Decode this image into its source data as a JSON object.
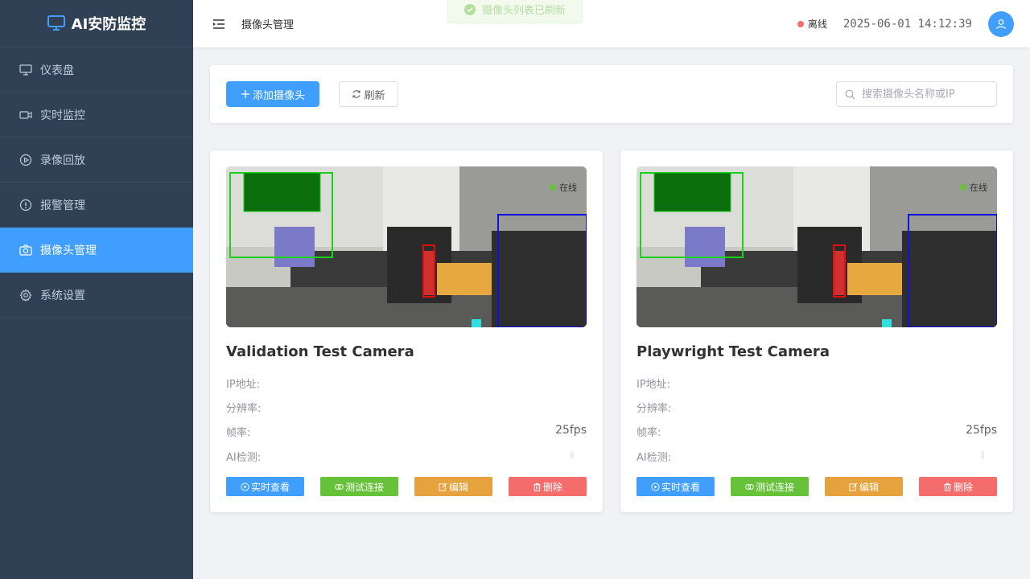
{
  "app": {
    "title": "AI安防监控"
  },
  "sidebar": {
    "items": [
      {
        "label": "仪表盘",
        "icon": "monitor-icon"
      },
      {
        "label": "实时监控",
        "icon": "video-camera-icon"
      },
      {
        "label": "录像回放",
        "icon": "play-circle-icon"
      },
      {
        "label": "报警管理",
        "icon": "warning-icon"
      },
      {
        "label": "摄像头管理",
        "icon": "camera-icon",
        "active": true
      },
      {
        "label": "系统设置",
        "icon": "gear-icon"
      }
    ]
  },
  "header": {
    "breadcrumb": "摄像头管理",
    "status_label": "离线",
    "status_color": "#f56c6c",
    "datetime": "2025-06-01 14:12:39"
  },
  "toast": {
    "message": "摄像头列表已刷新"
  },
  "toolbar": {
    "add_label": "添加摄像头",
    "refresh_label": "刷新",
    "search_placeholder": "搜索摄像头名称或IP"
  },
  "cameras": [
    {
      "name": "Validation Test Camera",
      "status": "在线",
      "ip_label": "IP地址:",
      "ip_value": "",
      "resolution_label": "分辨率:",
      "resolution_value": "",
      "fps_label": "帧率:",
      "fps_value": "25fps",
      "ai_label": "AI检测:"
    },
    {
      "name": "Playwright Test Camera",
      "status": "在线",
      "ip_label": "IP地址:",
      "ip_value": "",
      "resolution_label": "分辨率:",
      "resolution_value": "",
      "fps_label": "帧率:",
      "fps_value": "25fps",
      "ai_label": "AI检测:"
    }
  ],
  "card_actions": {
    "view_label": "实时查看",
    "test_label": "测试连接",
    "edit_label": "编辑",
    "delete_label": "删除"
  },
  "colors": {
    "primary": "#409eff",
    "success": "#67c23a",
    "warning": "#e6a23c",
    "danger": "#f56c6c",
    "sidebar": "#304156"
  }
}
